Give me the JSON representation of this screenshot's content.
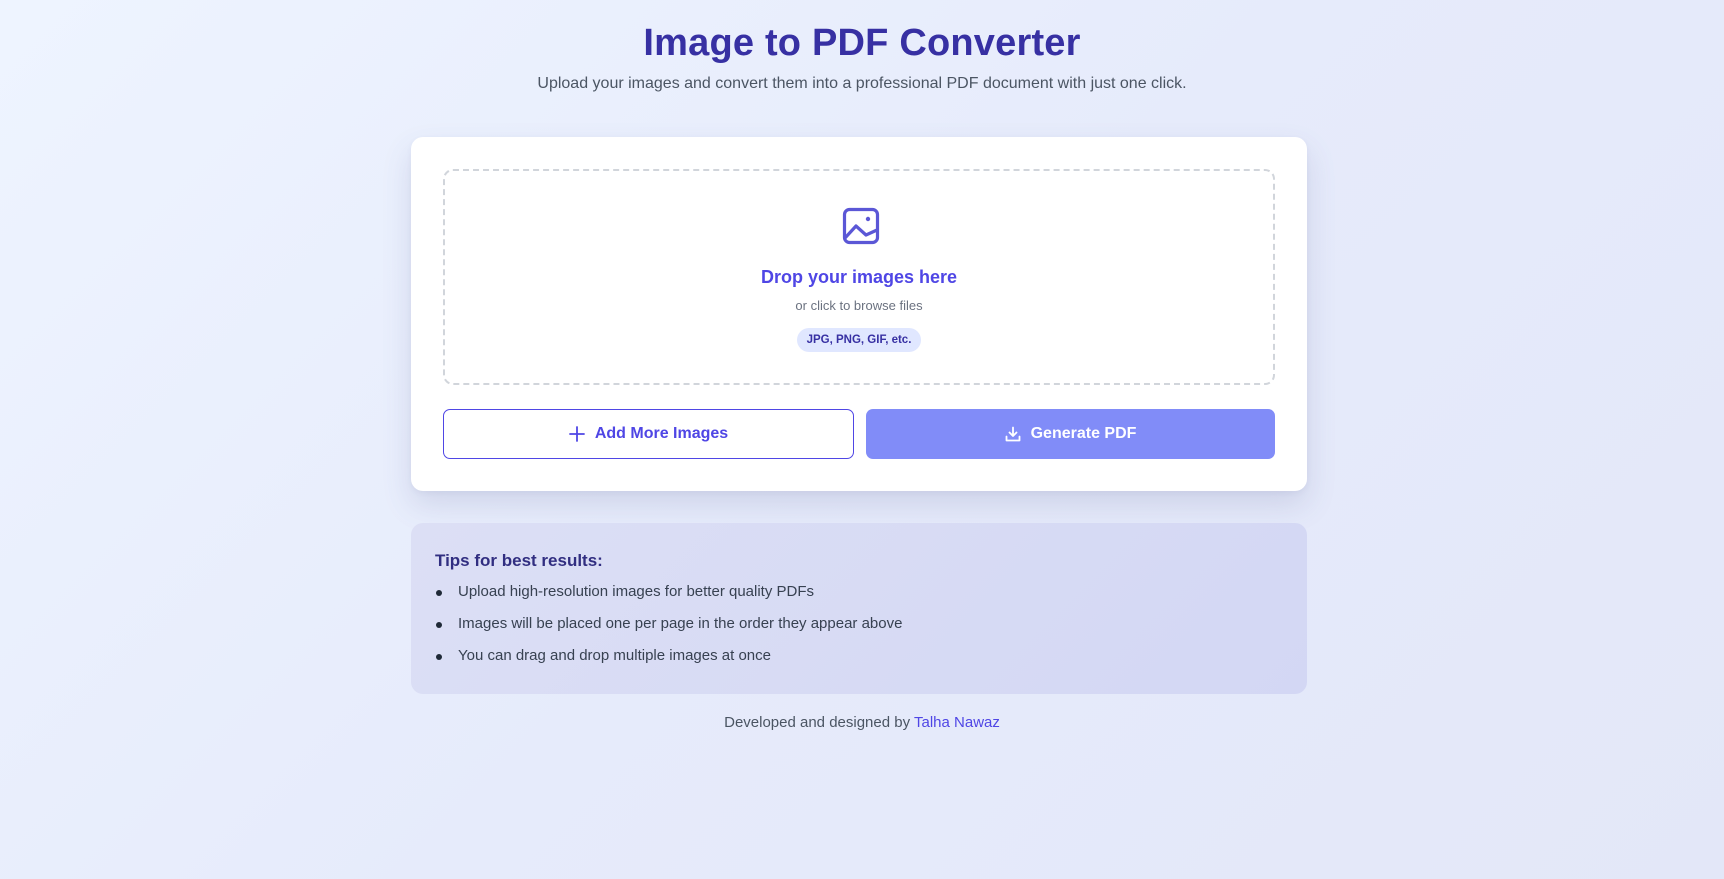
{
  "header": {
    "title": "Image to PDF Converter",
    "subtitle": "Upload your images and convert them into a professional PDF document with just one click."
  },
  "dropzone": {
    "icon": "image-icon",
    "title": "Drop your images here",
    "hint": "or click to browse files",
    "formats": "JPG, PNG, GIF, etc."
  },
  "actions": {
    "add_label": "Add More Images",
    "add_icon": "plus-icon",
    "generate_label": "Generate PDF",
    "generate_icon": "download-icon"
  },
  "tips": {
    "title": "Tips for best results:",
    "items": [
      "Upload high-resolution images for better quality PDFs",
      "Images will be placed one per page in the order they appear above",
      "You can drag and drop multiple images at once"
    ]
  },
  "footer": {
    "text": "Developed and designed by",
    "author": "Talha Nawaz"
  },
  "colors": {
    "accent": "#4f46e5",
    "title": "#3730a3",
    "generate_button": "#818cf8",
    "tips_background": "#d8dbf5"
  }
}
